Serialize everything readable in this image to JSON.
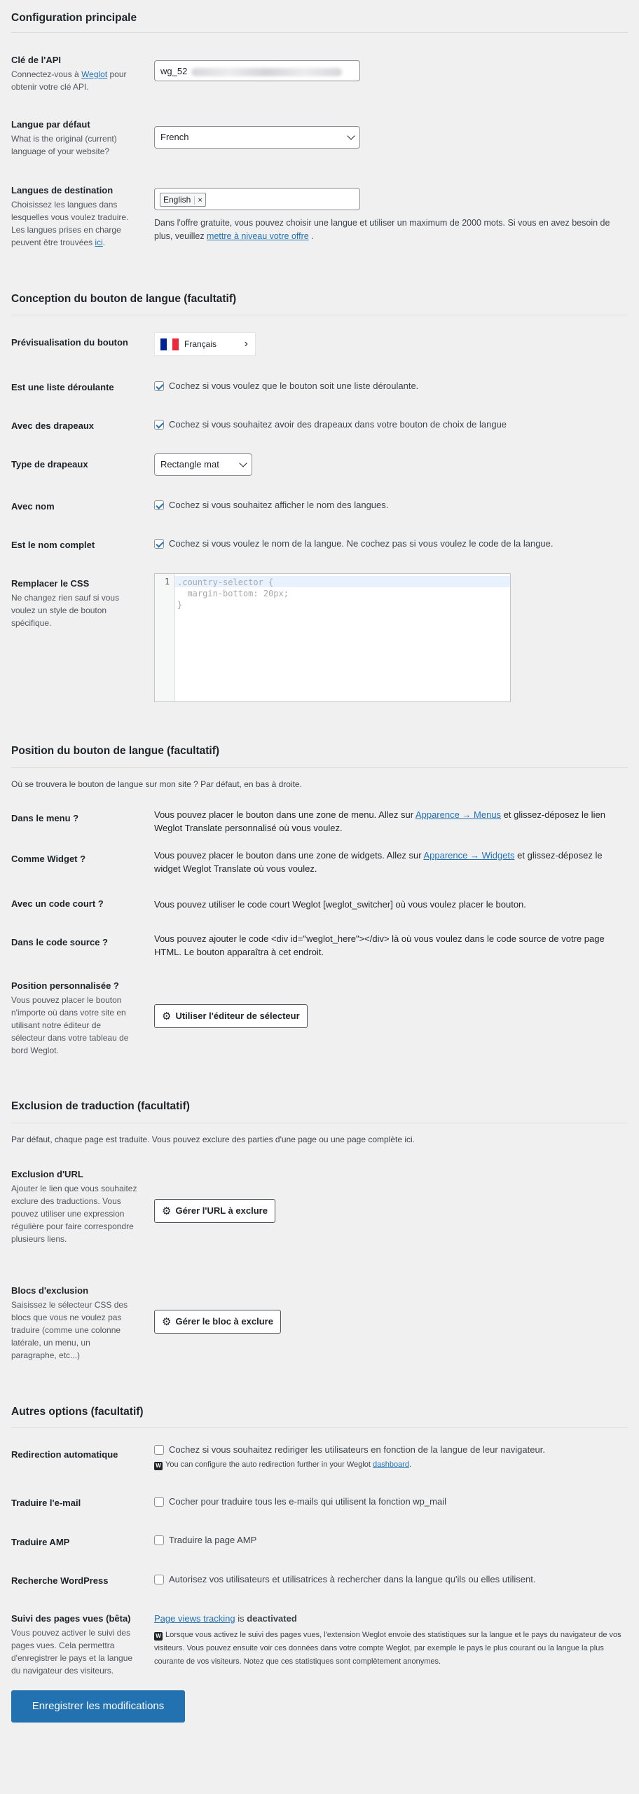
{
  "main": {
    "title": "Configuration principale",
    "api_key": {
      "label": "Clé de l'API",
      "desc_before": "Connectez-vous à ",
      "desc_link": "Weglot",
      "desc_after": " pour obtenir votre clé API.",
      "value": "wg_52"
    },
    "default_lang": {
      "label": "Langue par défaut",
      "desc": "What is the original (current) language of your website?",
      "value": "French"
    },
    "dest_langs": {
      "label": "Langues de destination",
      "desc_before": "Choisissez les langues dans lesquelles vous voulez traduire. Les langues prises en charge peuvent être trouvées ",
      "desc_link": "ici",
      "desc_after": ".",
      "tag": "English",
      "tag_remove": "×",
      "note_before": "Dans l'offre gratuite, vous pouvez choisir une langue et utiliser un maximum de 2000 mots. Si vous en avez besoin de plus, veuillez ",
      "note_link": "mettre à niveau votre offre",
      "note_after": " ."
    }
  },
  "button": {
    "title": "Conception du bouton de langue (facultatif)",
    "preview": {
      "label": "Prévisualisation du bouton",
      "lang": "Français",
      "arrow": "›"
    },
    "dropdown": {
      "label": "Est une liste déroulante",
      "text": "Cochez si vous voulez que le bouton soit une liste déroulante.",
      "checked": true
    },
    "flags": {
      "label": "Avec des drapeaux",
      "text": "Cochez si vous souhaitez avoir des drapeaux dans votre bouton de choix de langue",
      "checked": true
    },
    "flag_type": {
      "label": "Type de drapeaux",
      "value": "Rectangle mat"
    },
    "with_name": {
      "label": "Avec nom",
      "text": "Cochez si vous souhaitez afficher le nom des langues.",
      "checked": true
    },
    "full_name": {
      "label": "Est le nom complet",
      "text": "Cochez si vous voulez le nom de la langue. Ne cochez pas si vous voulez le code de la langue.",
      "checked": true
    },
    "css": {
      "label": "Remplacer le CSS",
      "desc": "Ne changez rien sauf si vous voulez un style de bouton spécifique.",
      "line_number": "1",
      "code": ".country-selector {\n  margin-bottom: 20px;\n}"
    }
  },
  "position": {
    "title": "Position du bouton de langue (facultatif)",
    "intro": "Où se trouvera le bouton de langue sur mon site ? Par défaut, en bas à droite.",
    "menu": {
      "label": "Dans le menu ?",
      "before": "Vous pouvez placer le bouton dans une zone de menu. Allez sur ",
      "link": "Apparence → Menus",
      "after": " et glissez-déposez le lien Weglot Translate personnalisé où vous voulez."
    },
    "widget": {
      "label": "Comme Widget ?",
      "before": "Vous pouvez placer le bouton dans une zone de widgets. Allez sur ",
      "link": "Apparence → Widgets",
      "after": " et glissez-déposez le widget Weglot Translate où vous voulez."
    },
    "shortcode": {
      "label": "Avec un code court ?",
      "text": "Vous pouvez utiliser le code court Weglot [weglot_switcher] où vous voulez placer le bouton."
    },
    "source": {
      "label": "Dans le code source ?",
      "text": "Vous pouvez ajouter le code <div id=\"weglot_here\"></div> là où vous voulez dans le code source de votre page HTML. Le bouton apparaîtra à cet endroit."
    },
    "custom": {
      "label": "Position personnalisée ?",
      "desc": "Vous pouvez placer le bouton n'importe où dans votre site en utilisant notre éditeur de sélecteur dans votre tableau de bord Weglot.",
      "button": "Utiliser l'éditeur de sélecteur"
    }
  },
  "exclusion": {
    "title": "Exclusion de traduction (facultatif)",
    "intro": "Par défaut, chaque page est traduite. Vous pouvez exclure des parties d'une page ou une page complète ici.",
    "url": {
      "label": "Exclusion d'URL",
      "desc": "Ajouter le lien que vous souhaitez exclure des traductions. Vous pouvez utiliser une expression régulière pour faire correspondre plusieurs liens.",
      "button": "Gérer l'URL à exclure"
    },
    "blocks": {
      "label": "Blocs d'exclusion",
      "desc": "Saisissez le sélecteur CSS des blocs que vous ne voulez pas traduire (comme une colonne latérale, un menu, un paragraphe, etc...)",
      "button": "Gérer le bloc à exclure"
    }
  },
  "other": {
    "title": "Autres options (facultatif)",
    "redirect": {
      "label": "Redirection automatique",
      "text": "Cochez si vous souhaitez rediriger les utilisateurs en fonction de la langue de leur navigateur.",
      "note_before": "You can configure the auto redirection further in your Weglot ",
      "note_link": "dashboard",
      "note_after": ".",
      "checked": false
    },
    "email": {
      "label": "Traduire l'e-mail",
      "text": "Cocher pour traduire tous les e-mails qui utilisent la fonction wp_mail",
      "checked": false
    },
    "amp": {
      "label": "Traduire AMP",
      "text": "Traduire la page AMP",
      "checked": false
    },
    "search": {
      "label": "Recherche WordPress",
      "text": "Autorisez vos utilisateurs et utilisatrices à rechercher dans la langue qu'ils ou elles utilisent.",
      "checked": false
    },
    "pageviews": {
      "label": "Suivi des pages vues (bêta)",
      "desc": "Vous pouvez activer le suivi des pages vues. Cela permettra d'enregistrer le pays et la langue du navigateur des visiteurs.",
      "status_link": "Page views tracking",
      "status_is": " is ",
      "status_value": "deactivated",
      "note": "Lorsque vous activez le suivi des pages vues, l'extension Weglot envoie des statistiques sur la langue et le pays du navigateur de vos visiteurs. Vous pouvez ensuite voir ces données dans votre compte Weglot, par exemple le pays le plus courant ou la langue la plus courante de vos visiteurs. Notez que ces statistiques sont complètement anonymes."
    }
  },
  "footer": {
    "save": "Enregistrer les modifications"
  },
  "icons": {
    "gear": "⚙",
    "info": "W"
  },
  "colors": {
    "accent": "#2271b1",
    "flag_blue": "#002395",
    "flag_white": "#ffffff",
    "flag_red": "#ed2939"
  }
}
